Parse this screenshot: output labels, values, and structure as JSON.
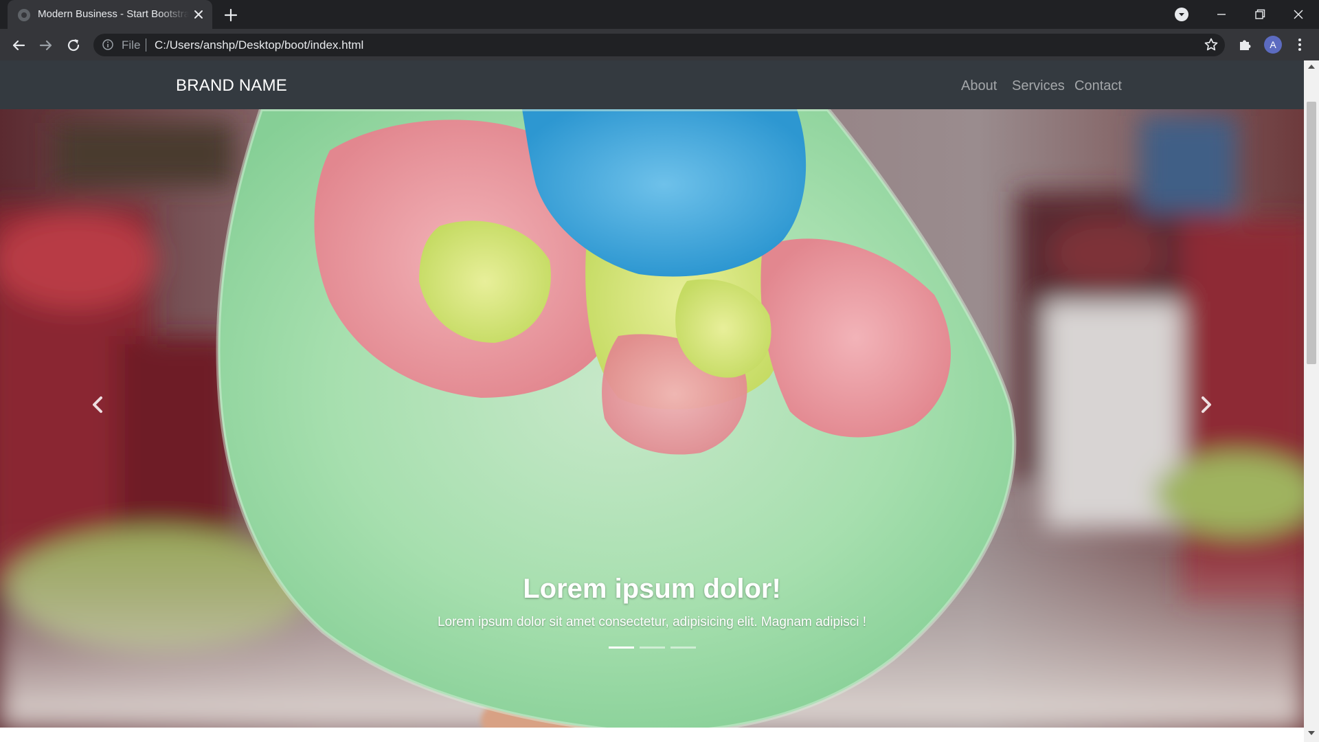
{
  "browser": {
    "tab_title": "Modern Business - Start Bootstrap Template",
    "file_label": "File",
    "url": "C:/Users/anshp/Desktop/boot/index.html",
    "profile_initial": "A",
    "icons": [
      "tab-favicon-icon",
      "close-icon",
      "plus-icon",
      "profile-dropdown-icon",
      "minimize-icon",
      "maximize-icon",
      "close-window-icon",
      "back-arrow-icon",
      "forward-arrow-icon",
      "reload-icon",
      "info-icon",
      "star-icon",
      "puzzle-icon",
      "kebab-menu-icon",
      "scroll-up-icon",
      "scroll-down-icon"
    ]
  },
  "site": {
    "brand": "BRAND NAME",
    "nav": [
      {
        "label": "About"
      },
      {
        "label": "Services"
      },
      {
        "label": "Contact"
      }
    ],
    "navbar_color": "#343a40"
  },
  "carousel": {
    "caption_title": "Lorem ipsum dolor!",
    "caption_text": "Lorem ipsum dolor sit amet consectetur, adipisicing elit. Magnam adipisci !",
    "slide_count": 3,
    "active_index": 0,
    "image_description": "cotton candy"
  }
}
